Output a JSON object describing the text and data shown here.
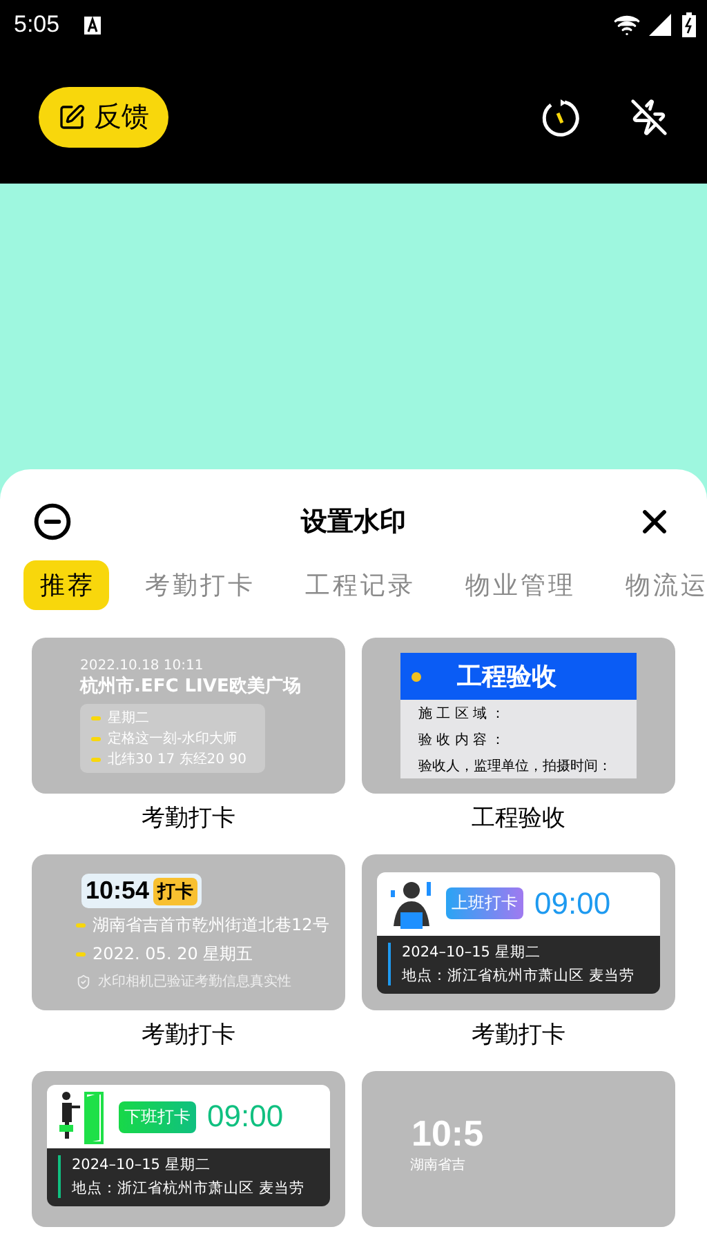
{
  "status_bar": {
    "time": "5:05"
  },
  "toolbar": {
    "feedback_button": "反馈"
  },
  "sheet": {
    "title": "设置水印",
    "tabs": [
      {
        "label": "推荐",
        "selected": true
      },
      {
        "label": "考勤打卡",
        "selected": false
      },
      {
        "label": "工程记录",
        "selected": false
      },
      {
        "label": "物业管理",
        "selected": false
      },
      {
        "label": "物流运",
        "selected": false
      }
    ],
    "templates": [
      {
        "kind": "location",
        "label": "考勤打卡",
        "datetime": "2022.10.18 10:11",
        "place": "杭州市.EFC LIVE欧美广场",
        "lines": [
          "星期二",
          "定格这一刻-水印大师",
          "北纬30 17 东经20 90"
        ]
      },
      {
        "kind": "acceptance",
        "label": "工程验收",
        "heading": "工程验收",
        "lines": [
          "施 工 区 域 ：",
          "验 收 内 容 ：",
          "验收人，监理单位，拍摄时间："
        ]
      },
      {
        "kind": "punch",
        "label": "考勤打卡",
        "time": "10:54",
        "tag": "打卡",
        "lines": [
          "湖南省吉首市乾州街道北巷12号",
          "2022. 05. 20  星期五"
        ],
        "note": "水印相机已验证考勤信息真实性"
      },
      {
        "kind": "clock_in",
        "label": "考勤打卡",
        "tag": "上班打卡",
        "time": "09:00",
        "lines": [
          "2024–10–15 星期二",
          "地点：浙江省杭州市萧山区 麦当劳"
        ]
      },
      {
        "kind": "clock_out",
        "tag": "下班打卡",
        "time": "09:00",
        "lines": [
          "2024–10–15 星期二",
          "地点：浙江省杭州市萧山区 麦当劳"
        ]
      },
      {
        "kind": "partial",
        "time": "10:5",
        "lines": [
          "湖南省吉"
        ]
      }
    ]
  }
}
